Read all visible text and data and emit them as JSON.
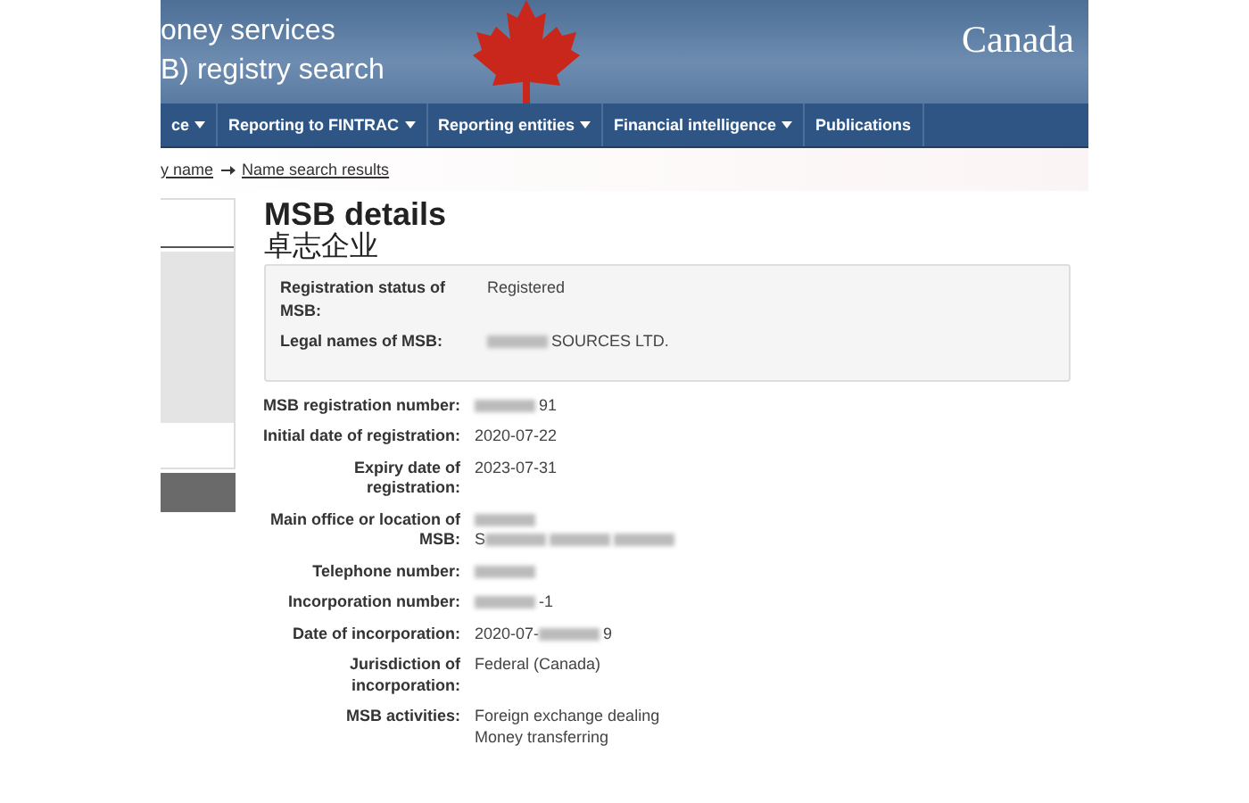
{
  "header": {
    "title_lines": [
      "oney services",
      "B) registry search"
    ],
    "wordmark": "Canada"
  },
  "nav": [
    {
      "label": "ce",
      "dropdown": true
    },
    {
      "label": "Reporting to FINTRAC",
      "dropdown": true
    },
    {
      "label": "Reporting entities",
      "dropdown": true
    },
    {
      "label": "Financial intelligence",
      "dropdown": true
    },
    {
      "label": "Publications",
      "dropdown": false
    }
  ],
  "breadcrumb": [
    {
      "label": "y name"
    },
    {
      "label": "Name search results"
    }
  ],
  "page_title": "MSB details",
  "subtitle": "卓志企业",
  "summary": [
    {
      "label": "Registration status of\nMSB:",
      "value": [
        {
          "text": "Registered"
        }
      ]
    },
    {
      "label": "Legal names of MSB:",
      "value": [
        {
          "kind": "redacted"
        },
        {
          "text": "SOURCES LTD."
        }
      ]
    }
  ],
  "details": [
    {
      "label": "MSB registration number:",
      "value": [
        {
          "kind": "redacted"
        },
        {
          "text": "91"
        }
      ]
    },
    {
      "label": "Initial date of registration:",
      "value": [
        {
          "text": "2020-07-22"
        }
      ]
    },
    {
      "label": "Expiry date of\nregistration:",
      "value": [
        {
          "text": "2023-07-31"
        }
      ]
    },
    {
      "label": "Main office or location of\nMSB:",
      "value": [
        {
          "kind": "redacted"
        },
        {
          "kind": "break"
        },
        {
          "text": "S"
        },
        {
          "kind": "redacted"
        },
        {
          "kind": "redacted"
        },
        {
          "kind": "redacted"
        }
      ]
    },
    {
      "label": "Telephone number:",
      "value": [
        {
          "kind": "redacted"
        }
      ]
    },
    {
      "label": "Incorporation number:",
      "value": [
        {
          "kind": "redacted"
        },
        {
          "text": "-1"
        }
      ]
    },
    {
      "label": "Date of incorporation:",
      "value": [
        {
          "text": "2020-07-"
        },
        {
          "kind": "redacted"
        },
        {
          "text": "9"
        }
      ]
    },
    {
      "label": "Jurisdiction of\nincorporation:",
      "value": [
        {
          "text": "Federal (Canada)"
        }
      ]
    },
    {
      "label": "MSB activities:",
      "value": [
        {
          "text": "Foreign exchange dealing"
        },
        {
          "kind": "break"
        },
        {
          "text": "Money transferring"
        }
      ]
    }
  ]
}
